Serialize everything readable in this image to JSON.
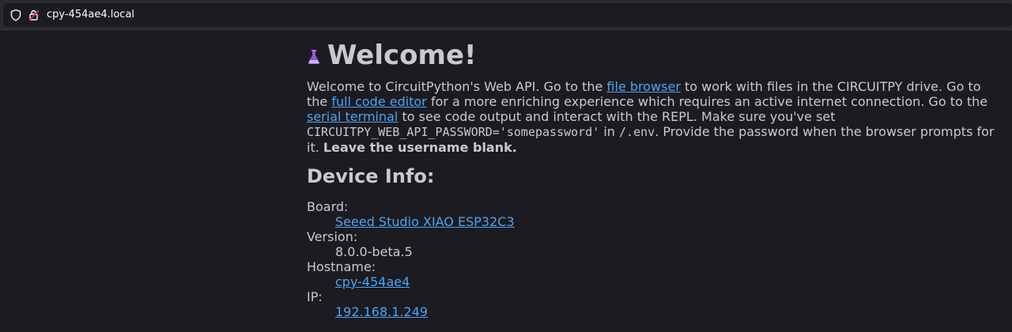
{
  "browser": {
    "url": "cpy-454ae4.local",
    "icons": [
      "shield-icon",
      "insecure-lock-icon"
    ]
  },
  "page": {
    "title": "Welcome!",
    "title_icon": "flask-icon",
    "intro": {
      "t1": "Welcome to CircuitPython's Web API. Go to the ",
      "link_file_browser": "file browser",
      "t2": " to work with files in the CIRCUITPY drive. Go to the ",
      "link_code_editor": "full code editor",
      "t3": " for a more enriching experience which requires an active internet connection. Go to the ",
      "link_serial_terminal": "serial terminal",
      "t4": " to see code output and interact with the REPL. Make sure you've set ",
      "code1": "CIRCUITPY_WEB_API_PASSWORD='somepassword'",
      "t5": " in ",
      "code2": "/.env",
      "t6": ". Provide the password when the browser prompts for it. ",
      "bold": "Leave the username blank."
    },
    "device_info": {
      "heading": "Device Info:",
      "board_label": "Board:",
      "board_value": "Seeed Studio XIAO ESP32C3",
      "version_label": "Version:",
      "version_value": "8.0.0-beta.5",
      "hostname_label": "Hostname:",
      "hostname_value": "cpy-454ae4",
      "ip_label": "IP:",
      "ip_value": "192.168.1.249"
    }
  },
  "colors": {
    "background": "#1c1b22",
    "text": "#c9c9d1",
    "link": "#4ea3f0"
  }
}
